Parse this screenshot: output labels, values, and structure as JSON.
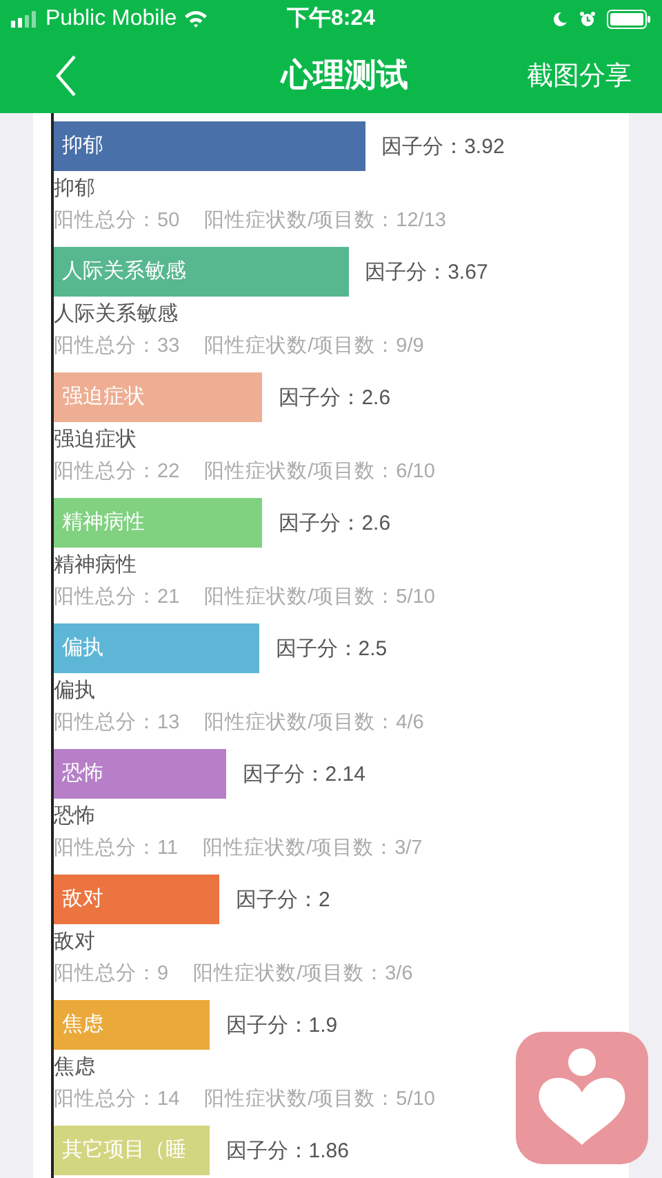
{
  "status_bar": {
    "carrier": "Public Mobile",
    "time": "下午8:24"
  },
  "nav": {
    "title": "心理测试",
    "action": "截图分享"
  },
  "factors": [
    {
      "label": "抑郁",
      "color": "#4a70aa",
      "level": 0.94,
      "score": "因子分：3.92",
      "name": "抑郁",
      "total": "阳性总分：50",
      "ratio": "阳性症状数/项目数：12/13"
    },
    {
      "label": "人际关系敏感",
      "color": "#57b78f",
      "level": 0.89,
      "score": "因子分：3.67",
      "name": "人际关系敏感",
      "total": "阳性总分：33",
      "ratio": "阳性症状数/项目数：9/9"
    },
    {
      "label": "强迫症状",
      "color": "#eeae93",
      "level": 0.63,
      "score": "因子分：2.6",
      "name": "强迫症状",
      "total": "阳性总分：22",
      "ratio": "阳性症状数/项目数：6/10"
    },
    {
      "label": "精神病性",
      "color": "#80d180",
      "level": 0.63,
      "score": "因子分：2.6",
      "name": "精神病性",
      "total": "阳性总分：21",
      "ratio": "阳性症状数/项目数：5/10"
    },
    {
      "label": "偏执",
      "color": "#5eb6d6",
      "level": 0.62,
      "score": "因子分：2.5",
      "name": "偏执",
      "total": "阳性总分：13",
      "ratio": "阳性症状数/项目数：4/6"
    },
    {
      "label": "恐怖",
      "color": "#b67fc8",
      "level": 0.52,
      "score": "因子分：2.14",
      "name": "恐怖",
      "total": "阳性总分：11",
      "ratio": "阳性症状数/项目数：3/7"
    },
    {
      "label": "敌对",
      "color": "#ec7440",
      "level": 0.5,
      "score": "因子分：2",
      "name": "敌对",
      "total": "阳性总分：9",
      "ratio": "阳性症状数/项目数：3/6"
    },
    {
      "label": "焦虑",
      "color": "#eaa93a",
      "level": 0.47,
      "score": "因子分：1.9",
      "name": "焦虑",
      "total": "阳性总分：14",
      "ratio": "阳性症状数/项目数：5/10"
    },
    {
      "label": "其它项目（睡",
      "color": "#d3d680",
      "level": 0.47,
      "score": "因子分：1.86"
    }
  ]
}
